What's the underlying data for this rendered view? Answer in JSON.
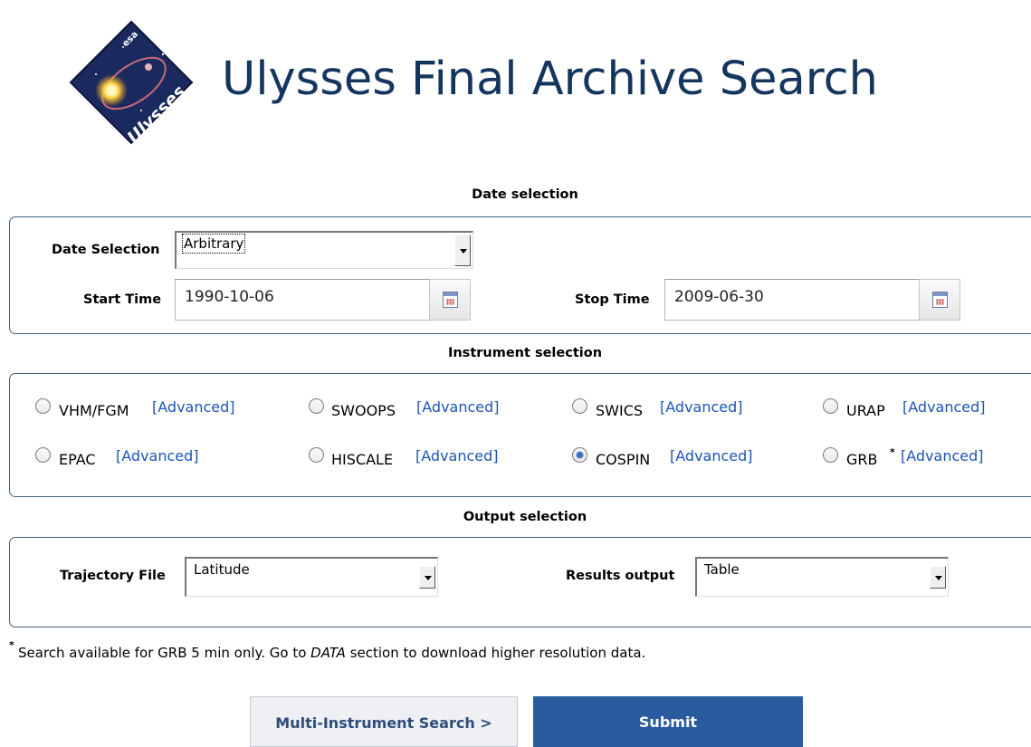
{
  "header": {
    "title": "Ulysses Final Archive Search",
    "logo_text": "Ulysses",
    "logo_agency": "esa"
  },
  "date_section": {
    "heading": "Date selection",
    "date_selection_label": "Date Selection",
    "date_selection_value": "Arbitrary",
    "start_time_label": "Start Time",
    "start_time_value": "1990-10-06",
    "stop_time_label": "Stop Time",
    "stop_time_value": "2009-06-30"
  },
  "instrument_section": {
    "heading": "Instrument selection",
    "advanced_label": "[Advanced]",
    "instruments": [
      {
        "name": "VHM/FGM",
        "checked": false
      },
      {
        "name": "SWOOPS",
        "checked": false
      },
      {
        "name": "SWICS",
        "checked": false
      },
      {
        "name": "URAP",
        "checked": false
      },
      {
        "name": "EPAC",
        "checked": false
      },
      {
        "name": "HISCALE",
        "checked": false
      },
      {
        "name": "COSPIN",
        "checked": true
      },
      {
        "name": "GRB",
        "checked": false,
        "footnote_marker": "*"
      }
    ]
  },
  "output_section": {
    "heading": "Output selection",
    "trajectory_label": "Trajectory File",
    "trajectory_value": "Latitude",
    "results_label": "Results output",
    "results_value": "Table"
  },
  "footnote": {
    "marker": "*",
    "text_before": "Search available for GRB 5 min only. Go to ",
    "emphasis": "DATA",
    "text_after": " section to download higher resolution data."
  },
  "buttons": {
    "multi_instrument": "Multi-Instrument Search >",
    "submit": "Submit"
  },
  "colors": {
    "title": "#14355e",
    "link": "#1d54b8",
    "panel_border": "#44627f",
    "submit_bg": "#2a5b9f"
  }
}
